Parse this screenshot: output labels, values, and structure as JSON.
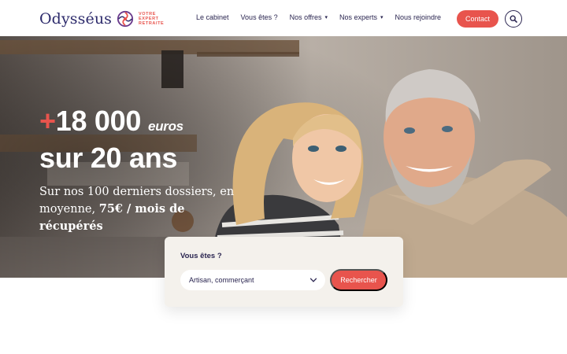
{
  "header": {
    "logo": {
      "word": "Odysséus",
      "tagline": [
        "VOTRE",
        "EXPERT",
        "RETRAITE"
      ]
    },
    "nav": [
      {
        "label": "Le cabinet",
        "has_dropdown": false
      },
      {
        "label": "Vous êtes ?",
        "has_dropdown": false
      },
      {
        "label": "Nos offres",
        "has_dropdown": true
      },
      {
        "label": "Nos experts",
        "has_dropdown": true
      },
      {
        "label": "Nous rejoindre",
        "has_dropdown": false
      }
    ],
    "contact_label": "Contact",
    "search_icon": "search-icon"
  },
  "hero": {
    "plus": "+",
    "amount": "18 000",
    "unit": "euros",
    "period": "sur 20 ans",
    "sub_prefix": "Sur nos 100 derniers dossiers,  en moyenne, ",
    "sub_bold": "75€ / mois de récupérés"
  },
  "search_card": {
    "title": "Vous êtes ?",
    "selected": "Artisan, commerçant",
    "button": "Rechercher"
  },
  "colors": {
    "accent": "#e8544d",
    "navy": "#2a2550",
    "card_bg": "#f4f1ec"
  }
}
